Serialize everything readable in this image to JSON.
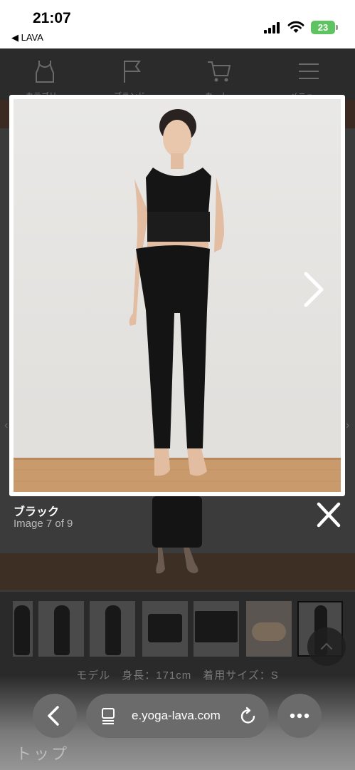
{
  "status_bar": {
    "time": "21:07",
    "back_app": "◀ LAVA",
    "battery": "23"
  },
  "site": {
    "nav_items": [
      {
        "icon": "tank-top-icon",
        "label": "カテゴリ"
      },
      {
        "icon": "flag-icon",
        "label": "ブランド"
      },
      {
        "icon": "cart-icon",
        "label": "カート"
      },
      {
        "icon": "menu-icon",
        "label": "メニュー"
      }
    ],
    "model_info": "モデル　身長：171cm　着用サイズ：S",
    "product_name_partial": "トップ"
  },
  "lightbox": {
    "title": "ブラック",
    "counter": "Image 7 of 9"
  },
  "browser": {
    "url": "e.yoga-lava.com"
  },
  "colors": {
    "overlay": "#1f1f1f",
    "frame": "#ffffff",
    "battery": "#5ec361",
    "toolbar_button": "#6b6b6b"
  }
}
